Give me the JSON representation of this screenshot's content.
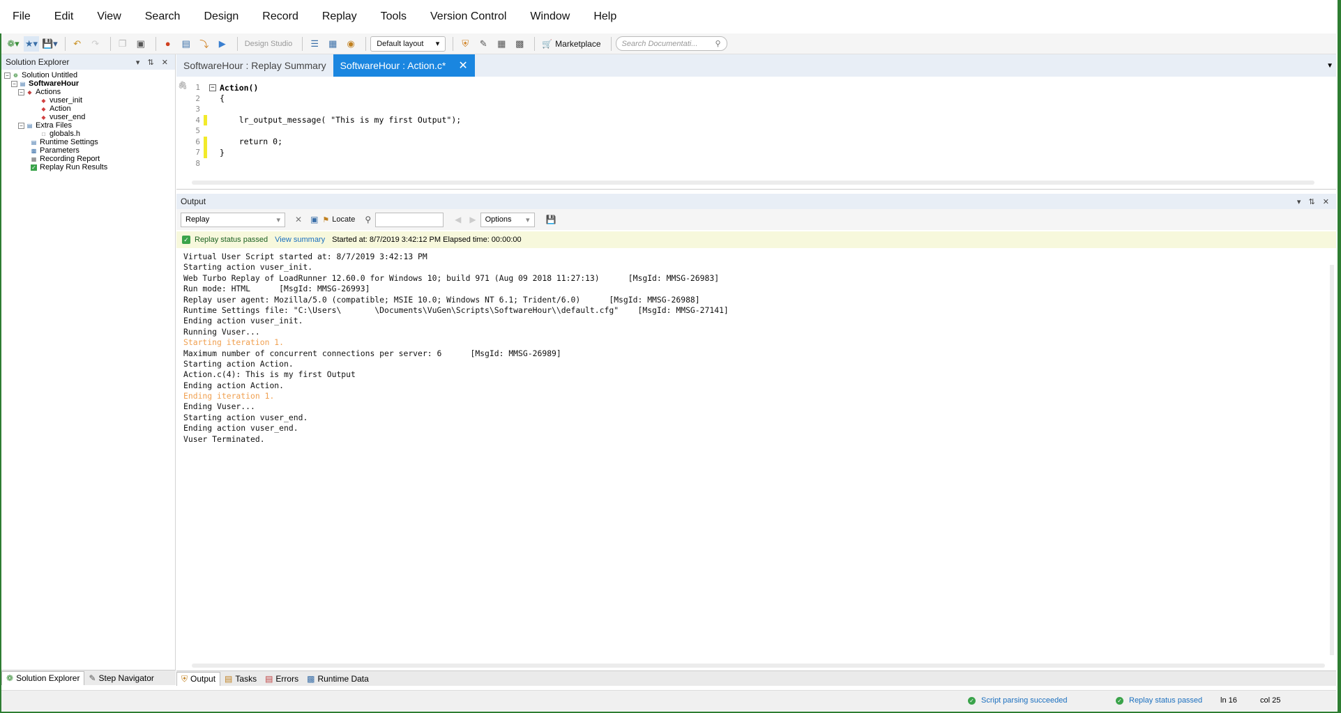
{
  "menu": [
    "File",
    "Edit",
    "View",
    "Search",
    "Design",
    "Record",
    "Replay",
    "Tools",
    "Version Control",
    "Window",
    "Help"
  ],
  "toolbar": {
    "design_studio": "Design Studio",
    "layout": "Default layout",
    "marketplace": "Marketplace",
    "search_placeholder": "Search Documentati..."
  },
  "solution_explorer": {
    "title": "Solution Explorer",
    "items": {
      "solution": "Solution Untitled",
      "script": "SoftwareHour",
      "actions": "Actions",
      "vuser_init": "vuser_init",
      "action": "Action",
      "vuser_end": "vuser_end",
      "extra_files": "Extra Files",
      "globals": "globals.h",
      "runtime_settings": "Runtime Settings",
      "parameters": "Parameters",
      "recording_report": "Recording Report",
      "replay_results": "Replay Run Results"
    },
    "bottom_tabs": [
      "Solution Explorer",
      "Step Navigator"
    ]
  },
  "tabs": {
    "replay_summary": "SoftwareHour : Replay Summary",
    "action": "SoftwareHour : Action.c*"
  },
  "editor": {
    "line_numbers": [
      "1",
      "2",
      "3",
      "4",
      "5",
      "6",
      "7",
      "8"
    ],
    "lines": [
      "Action()",
      "{",
      "",
      "    lr_output_message( \"This is my first Output\");",
      "",
      "    return 0;",
      "}",
      ""
    ]
  },
  "output": {
    "title": "Output",
    "filter": "Replay",
    "locate": "Locate",
    "options": "Options",
    "status": "Replay status passed",
    "view_summary": "View summary",
    "started": "Started at: 8/7/2019 3:42:12 PM Elapsed time: 00:00:00",
    "log": [
      "Virtual User Script started at: 8/7/2019 3:42:13 PM",
      "Starting action vuser_init.",
      "Web Turbo Replay of LoadRunner 12.60.0 for Windows 10; build 971 (Aug 09 2018 11:27:13)      [MsgId: MMSG-26983]",
      "Run mode: HTML      [MsgId: MMSG-26993]",
      "Replay user agent: Mozilla/5.0 (compatible; MSIE 10.0; Windows NT 6.1; Trident/6.0)      [MsgId: MMSG-26988]",
      "Runtime Settings file: \"C:\\Users\\       \\Documents\\VuGen\\Scripts\\SoftwareHour\\\\default.cfg\"    [MsgId: MMSG-27141]",
      "Ending action vuser_init.",
      "Running Vuser...",
      "Starting iteration 1.",
      "Maximum number of concurrent connections per server: 6      [MsgId: MMSG-26989]",
      "Starting action Action.",
      "Action.c(4): This is my first Output",
      "Ending action Action.",
      "Ending iteration 1.",
      "Ending Vuser...",
      "Starting action vuser_end.",
      "Ending action vuser_end.",
      "Vuser Terminated."
    ],
    "bottom_tabs": [
      "Output",
      "Tasks",
      "Errors",
      "Runtime Data"
    ]
  },
  "statusbar": {
    "parsing": "Script parsing succeeded",
    "replay": "Replay status passed",
    "line": "ln 16",
    "col": "col 25"
  }
}
